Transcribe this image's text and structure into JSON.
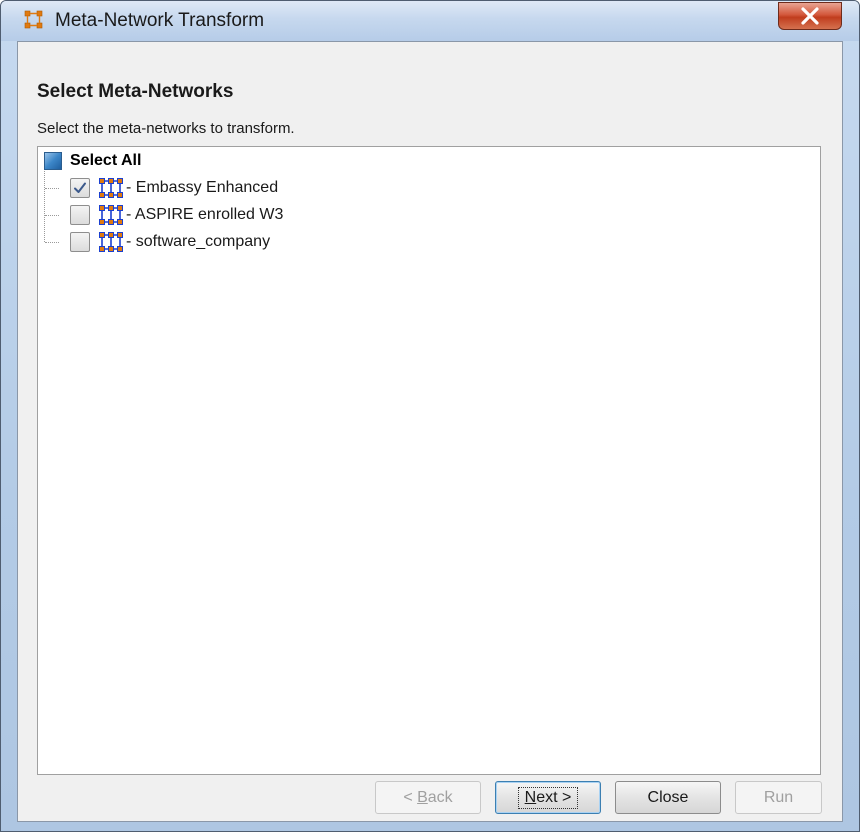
{
  "window": {
    "title": "Meta-Network Transform"
  },
  "page": {
    "heading": "Select Meta-Networks",
    "description": "Select the meta-networks to transform."
  },
  "tree": {
    "select_all_label": "Select All",
    "items": [
      {
        "label": "Embassy Enhanced",
        "checked": true
      },
      {
        "label": "ASPIRE enrolled W3",
        "checked": false
      },
      {
        "label": "software_company",
        "checked": false
      }
    ]
  },
  "buttons": {
    "back": {
      "prefix": "< ",
      "mnemonic": "B",
      "rest": "ack",
      "enabled": false
    },
    "next": {
      "mnemonic": "N",
      "rest": "ext >",
      "enabled": true
    },
    "close": {
      "label": "Close",
      "enabled": true
    },
    "run": {
      "label": "Run",
      "enabled": false
    }
  },
  "colors": {
    "close_button": "#c8452a",
    "select_all_box": "#3c86c8",
    "network_icon_blue": "#1a3fd0",
    "network_icon_orange": "#e07a10"
  }
}
